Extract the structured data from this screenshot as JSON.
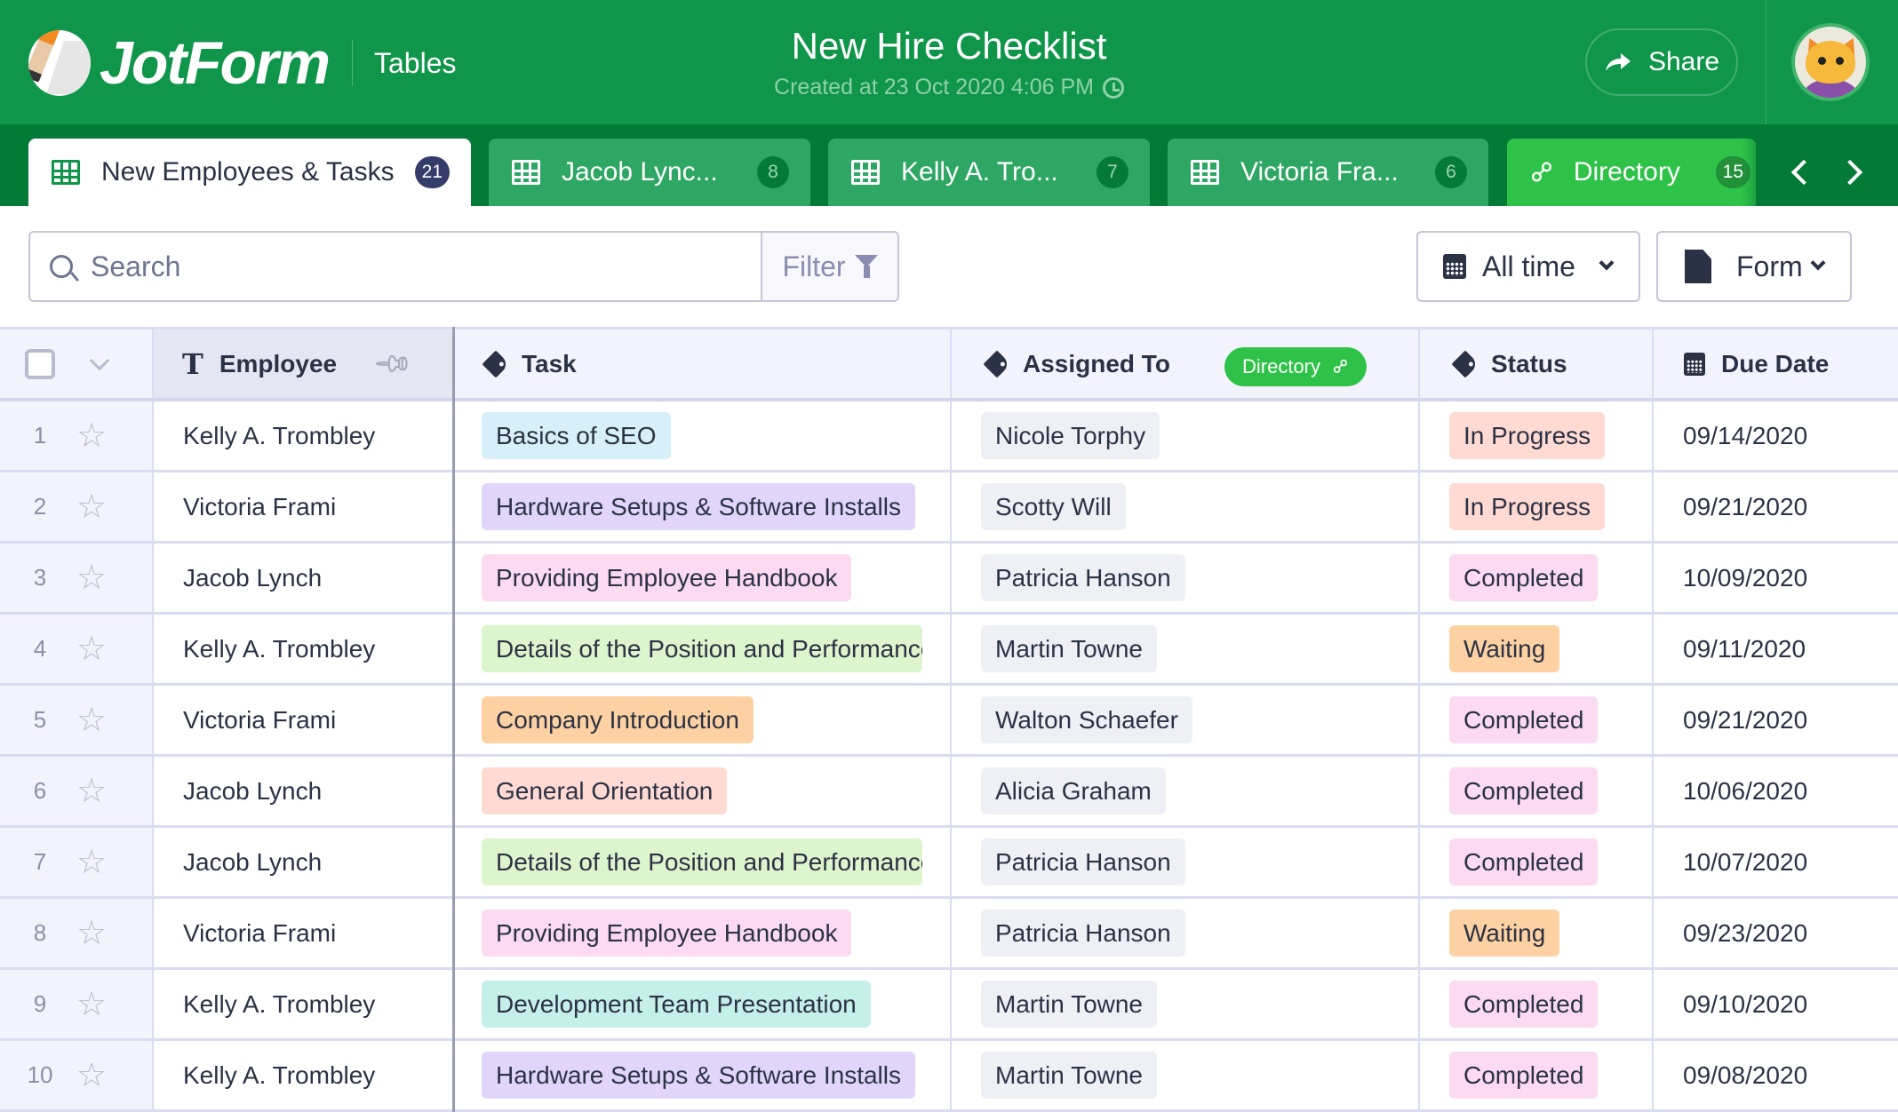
{
  "app": {
    "logo": "JotForm",
    "product": "Tables"
  },
  "header": {
    "title": "New Hire Checklist",
    "subtitle": "Created at 23 Oct 2020 4:06 PM",
    "share_label": "Share",
    "icons": {
      "share": "share-arrow-icon",
      "clock": "clock-icon",
      "avatar": "avatar-cat"
    }
  },
  "tabs": [
    {
      "label": "New Employees & Tasks",
      "count": "21",
      "icon": "grid-icon",
      "active": true
    },
    {
      "label": "Jacob Lync...",
      "count": "8",
      "icon": "grid-icon"
    },
    {
      "label": "Kelly A. Tro...",
      "count": "7",
      "icon": "grid-icon"
    },
    {
      "label": "Victoria Fra...",
      "count": "6",
      "icon": "grid-icon"
    },
    {
      "label": "Directory",
      "count": "15",
      "icon": "link-icon"
    }
  ],
  "toolbar": {
    "search_placeholder": "Search",
    "filter_label": "Filter",
    "date_filter": "All time",
    "form_filter": "Form"
  },
  "table": {
    "columns": {
      "employee": "Employee",
      "task": "Task",
      "assigned_to": "Assigned To",
      "assigned_link_badge": "Directory",
      "status": "Status",
      "due_date": "Due Date"
    },
    "rows": [
      {
        "n": "1",
        "employee": "Kelly A. Trombley",
        "task": "Basics of SEO",
        "task_color": "#d7effa",
        "assigned": "Nicole Torphy",
        "status": "In Progress",
        "status_color": "#ffdad2",
        "due": "09/14/2020"
      },
      {
        "n": "2",
        "employee": "Victoria Frami",
        "task": "Hardware Setups & Software Installs",
        "task_color": "#e1d5fb",
        "assigned": "Scotty Will",
        "status": "In Progress",
        "status_color": "#ffdad2",
        "due": "09/21/2020"
      },
      {
        "n": "3",
        "employee": "Jacob Lynch",
        "task": "Providing Employee Handbook",
        "task_color": "#fbdaf2",
        "assigned": "Patricia Hanson",
        "status": "Completed",
        "status_color": "#fbdaf2",
        "due": "10/09/2020"
      },
      {
        "n": "4",
        "employee": "Kelly A. Trombley",
        "task": "Details of the Position and Performance",
        "task_color": "#dcf5cd",
        "assigned": "Martin Towne",
        "status": "Waiting",
        "status_color": "#fed1a2",
        "due": "09/11/2020"
      },
      {
        "n": "5",
        "employee": "Victoria Frami",
        "task": "Company Introduction",
        "task_color": "#fed1a2",
        "assigned": "Walton Schaefer",
        "status": "Completed",
        "status_color": "#fbdaf2",
        "due": "09/21/2020"
      },
      {
        "n": "6",
        "employee": "Jacob Lynch",
        "task": "General Orientation",
        "task_color": "#ffdad2",
        "assigned": "Alicia Graham",
        "status": "Completed",
        "status_color": "#fbdaf2",
        "due": "10/06/2020"
      },
      {
        "n": "7",
        "employee": "Jacob Lynch",
        "task": "Details of the Position and Performance",
        "task_color": "#dcf5cd",
        "assigned": "Patricia Hanson",
        "status": "Completed",
        "status_color": "#fbdaf2",
        "due": "10/07/2020"
      },
      {
        "n": "8",
        "employee": "Victoria Frami",
        "task": "Providing Employee Handbook",
        "task_color": "#fbdaf2",
        "assigned": "Patricia Hanson",
        "status": "Waiting",
        "status_color": "#fed1a2",
        "due": "09/23/2020"
      },
      {
        "n": "9",
        "employee": "Kelly A. Trombley",
        "task": "Development Team Presentation",
        "task_color": "#c5efe9",
        "assigned": "Martin Towne",
        "status": "Completed",
        "status_color": "#fbdaf2",
        "due": "09/10/2020"
      },
      {
        "n": "10",
        "employee": "Kelly A. Trombley",
        "task": "Hardware Setups & Software Installs",
        "task_color": "#e1d5fb",
        "assigned": "Martin Towne",
        "status": "Completed",
        "status_color": "#fbdaf2",
        "due": "09/08/2020"
      }
    ]
  },
  "colors": {
    "brand_green": "#0f964a",
    "tab_strip": "#047a37",
    "tab_inactive": "#2ea764",
    "tab_link": "#2ec248",
    "assigned_chip": "#eff0f6"
  }
}
